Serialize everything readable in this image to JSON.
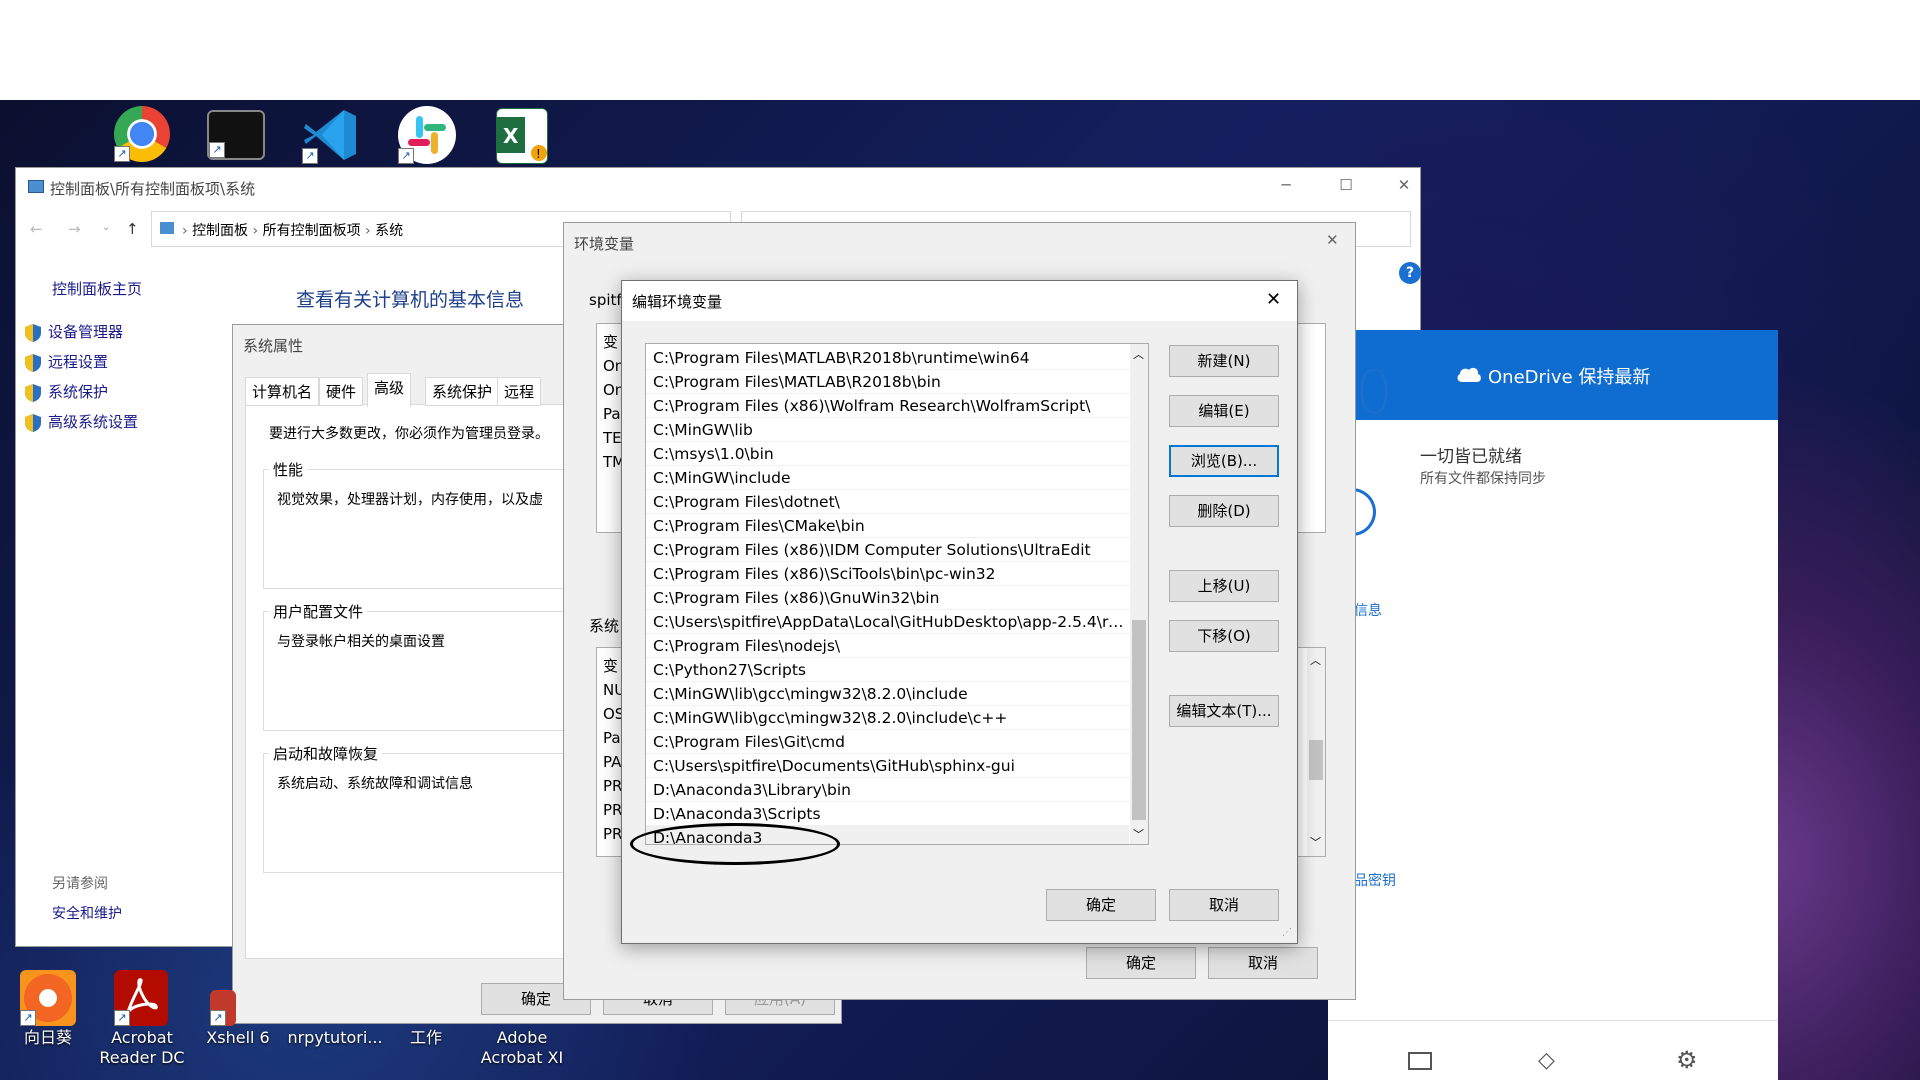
{
  "desktop_icons_top": [
    {
      "name": "chrome"
    },
    {
      "name": "terminal"
    },
    {
      "name": "vscode"
    },
    {
      "name": "slack"
    },
    {
      "name": "excel"
    }
  ],
  "desktop_icons_bottom": [
    {
      "label": "向日葵"
    },
    {
      "label": "Acrobat\nReader DC"
    },
    {
      "label": "Xshell 6"
    },
    {
      "label": "nrpytutori..."
    },
    {
      "label": "工作"
    },
    {
      "label": "Adobe\nAcrobat XI"
    }
  ],
  "control_panel": {
    "title": "控制面板\\所有控制面板项\\系统",
    "breadcrumb": [
      "控制面板",
      "所有控制面板项",
      "系统"
    ],
    "sidebar_home": "控制面板主页",
    "sidebar_links": [
      "设备管理器",
      "远程设置",
      "系统保护",
      "高级系统设置"
    ],
    "see_also": "另请参阅",
    "see_also_link": "安全和维护",
    "main_heading": "查看有关计算机的基本信息"
  },
  "sys_props": {
    "title": "系统属性",
    "tabs": [
      "计算机名",
      "硬件",
      "高级",
      "系统保护",
      "远程"
    ],
    "active_tab": "高级",
    "admin_note": "要进行大多数更改，你必须作为管理员登录。",
    "perf_title": "性能",
    "perf_desc": "视觉效果，处理器计划，内存使用，以及虚",
    "profile_title": "用户配置文件",
    "profile_desc": "与登录帐户相关的桌面设置",
    "startup_title": "启动和故障恢复",
    "startup_desc": "系统启动、系统故障和调试信息",
    "ok": "确定",
    "cancel": "取消",
    "apply": "应用(A)"
  },
  "env_vars": {
    "title": "环境变量",
    "user_label": "spitfi",
    "user_rows": [
      "变",
      "On",
      "On",
      "Pa",
      "TE",
      "TM"
    ],
    "sys_label": "系统",
    "sys_rows": [
      "变",
      "NU",
      "OS",
      "Pa",
      "PA",
      "PR",
      "PR",
      "PR"
    ],
    "ok": "确定",
    "cancel": "取消"
  },
  "edit_env": {
    "title": "编辑环境变量",
    "paths": [
      "C:\\Program Files\\MATLAB\\R2018b\\runtime\\win64",
      "C:\\Program Files\\MATLAB\\R2018b\\bin",
      "C:\\Program Files (x86)\\Wolfram Research\\WolframScript\\",
      "C:\\MinGW\\lib",
      "C:\\msys\\1.0\\bin",
      "C:\\MinGW\\include",
      "C:\\Program Files\\dotnet\\",
      "C:\\Program Files\\CMake\\bin",
      "C:\\Program Files (x86)\\IDM Computer Solutions\\UltraEdit",
      "C:\\Program Files (x86)\\SciTools\\bin\\pc-win32",
      "C:\\Program Files (x86)\\GnuWin32\\bin",
      "C:\\Users\\spitfire\\AppData\\Local\\GitHubDesktop\\app-2.5.4\\res...",
      "C:\\Program Files\\nodejs\\",
      "C:\\Python27\\Scripts",
      "C:\\MinGW\\lib\\gcc\\mingw32\\8.2.0\\include",
      "C:\\MinGW\\lib\\gcc\\mingw32\\8.2.0\\include\\c++",
      "C:\\Program Files\\Git\\cmd",
      "C:\\Users\\spitfire\\Documents\\GitHub\\sphinx-gui",
      "D:\\Anaconda3\\Library\\bin",
      "D:\\Anaconda3\\Scripts",
      "D:\\Anaconda3"
    ],
    "buttons": {
      "new": "新建(N)",
      "edit": "编辑(E)",
      "browse": "浏览(B)...",
      "delete": "删除(D)",
      "up": "上移(U)",
      "down": "下移(O)",
      "edit_text": "编辑文本(T)..."
    },
    "ok": "确定",
    "cancel": "取消"
  },
  "onedrive": {
    "header": "OneDrive 保持最新",
    "status": "一切皆已就绪",
    "sub": "所有文件都保持同步",
    "partial_big": "0",
    "partial_info": "信息",
    "partial_key": "品密钥"
  }
}
